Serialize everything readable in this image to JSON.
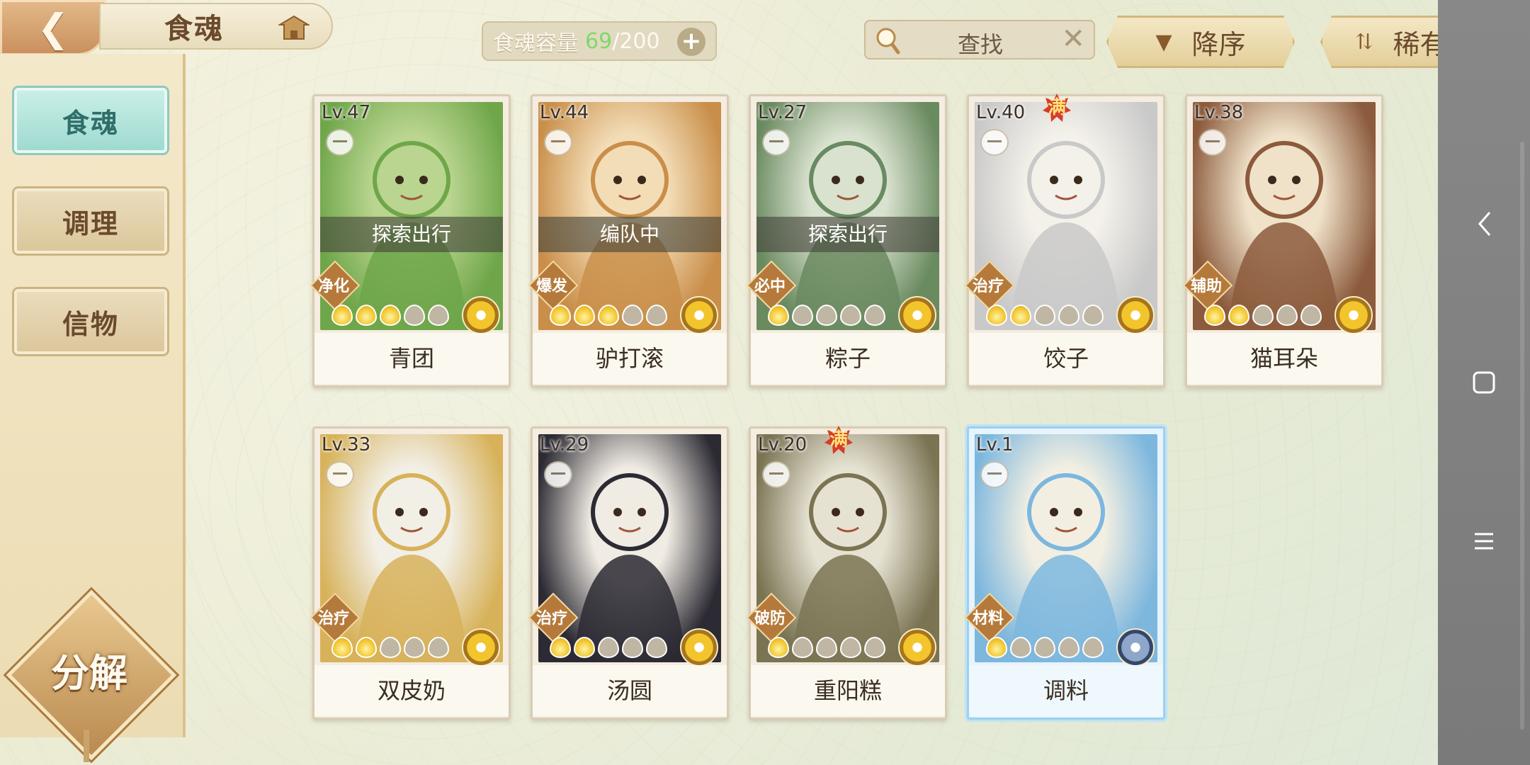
{
  "header": {
    "title": "食魂",
    "capacity_label": "食魂容量",
    "capacity_current": "69",
    "capacity_sep": "/",
    "capacity_max": "200",
    "capacity_add": "+",
    "search_placeholder": "查找",
    "search_clear": "✕",
    "sort_order_label": "降序",
    "sort_field_label": "稀有度"
  },
  "sidebar": {
    "tabs": [
      {
        "label": "食魂",
        "active": true
      },
      {
        "label": "调理",
        "active": false
      },
      {
        "label": "信物",
        "active": false
      }
    ],
    "decompose_label": "分解"
  },
  "cards": [
    {
      "level": "Lv.47",
      "name": "青团",
      "role": "净化",
      "status": "探索出行",
      "stars": 3,
      "full": false,
      "flower": "gold",
      "art": [
        "#6fa64a",
        "#b9d58f"
      ]
    },
    {
      "level": "Lv.44",
      "name": "驴打滚",
      "role": "爆发",
      "status": "编队中",
      "stars": 3,
      "full": false,
      "flower": "gold",
      "art": [
        "#c98f4a",
        "#f3ddb7"
      ]
    },
    {
      "level": "Lv.27",
      "name": "粽子",
      "role": "必中",
      "status": "探索出行",
      "stars": 1,
      "full": false,
      "flower": "gold",
      "art": [
        "#6a8a60",
        "#d9e2cf"
      ]
    },
    {
      "level": "Lv.40",
      "name": "饺子",
      "role": "治疗",
      "status": "",
      "stars": 2,
      "full": true,
      "full_label": "满",
      "flower": "gold",
      "art": [
        "#c9c9c9",
        "#f4f1ea"
      ]
    },
    {
      "level": "Lv.38",
      "name": "猫耳朵",
      "role": "辅助",
      "status": "",
      "stars": 2,
      "full": false,
      "flower": "gold",
      "art": [
        "#8c5a3c",
        "#efe2c9"
      ]
    },
    {
      "level": "Lv.33",
      "name": "双皮奶",
      "role": "治疗",
      "status": "",
      "stars": 2,
      "full": false,
      "flower": "gold",
      "art": [
        "#d7b25a",
        "#f2efe6"
      ]
    },
    {
      "level": "Lv.29",
      "name": "汤圆",
      "role": "治疗",
      "status": "",
      "stars": 2,
      "full": false,
      "flower": "gold",
      "art": [
        "#2c2a33",
        "#f0ebe3"
      ]
    },
    {
      "level": "Lv.20",
      "name": "重阳糕",
      "role": "破防",
      "status": "",
      "stars": 1,
      "full": true,
      "full_label": "满",
      "flower": "gold",
      "art": [
        "#7a7453",
        "#e6e2d2"
      ]
    },
    {
      "level": "Lv.1",
      "name": "调料",
      "role": "材料",
      "status": "",
      "stars": 1,
      "full": false,
      "flower": "blue",
      "art": [
        "#7db7de",
        "#f2efe2"
      ]
    }
  ],
  "nav": {
    "back": "back-icon",
    "home": "home-icon",
    "menu": "menu-icon"
  }
}
